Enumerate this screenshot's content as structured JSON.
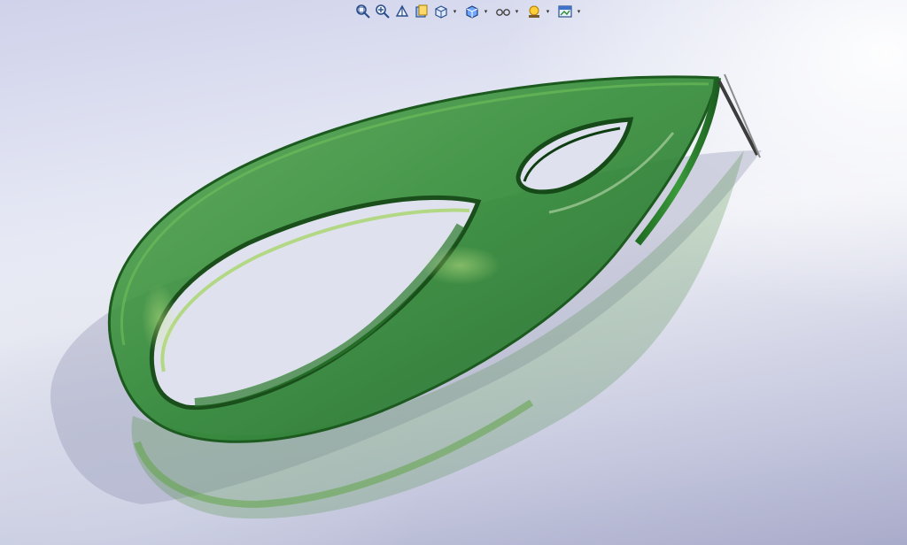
{
  "window": {
    "title": ""
  },
  "toolbar": {
    "buttons": [
      {
        "name": "zoom-to-fit-icon",
        "dropdown": false
      },
      {
        "name": "zoom-to-area-icon",
        "dropdown": false
      },
      {
        "name": "previous-view-icon",
        "dropdown": false
      },
      {
        "name": "section-view-icon",
        "dropdown": false
      },
      {
        "name": "view-orientation-icon",
        "dropdown": true
      },
      {
        "name": "display-style-icon",
        "dropdown": true
      },
      {
        "name": "hide-show-items-icon",
        "dropdown": true
      },
      {
        "name": "edit-appearance-icon",
        "dropdown": true
      },
      {
        "name": "apply-scene-icon",
        "dropdown": true
      }
    ],
    "dropdown_glyph": "▾"
  },
  "model": {
    "part_color": "#2e8b2e",
    "edge_color": "#1d5e1d",
    "highlight_color": "#8ccf55",
    "background_top": "#cfd2ea",
    "background_bottom": "#a9abca"
  }
}
